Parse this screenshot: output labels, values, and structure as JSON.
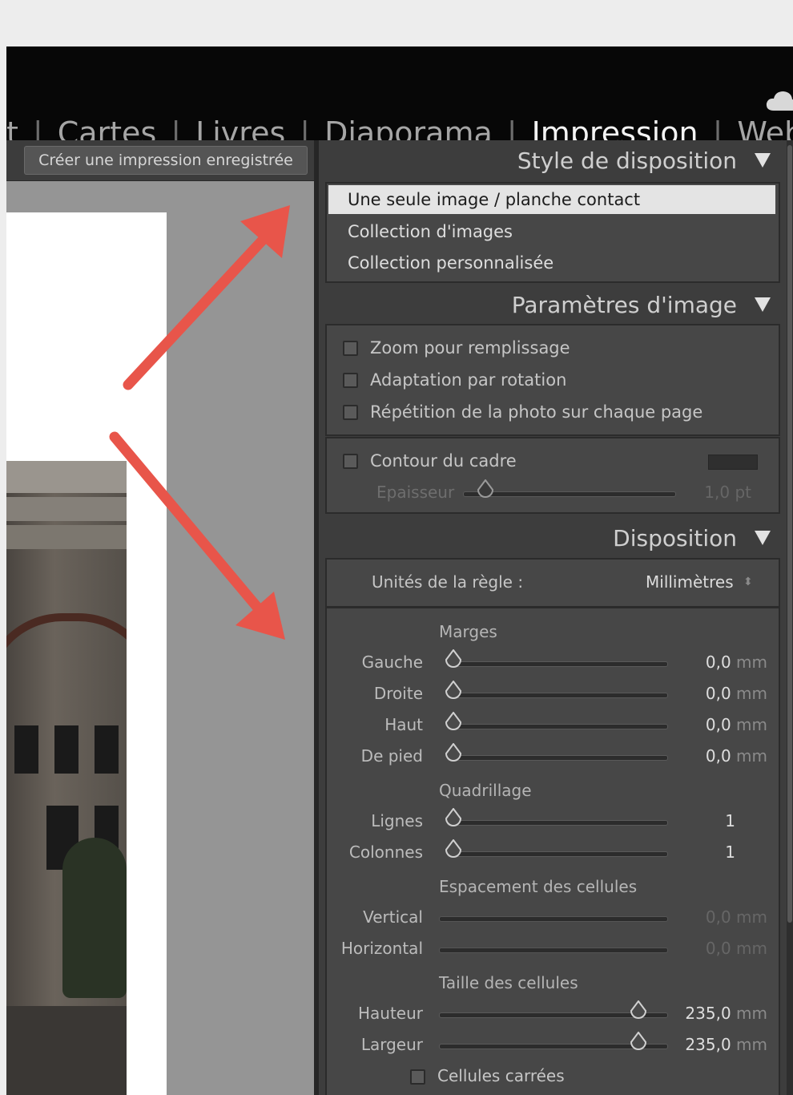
{
  "modules": {
    "items": [
      {
        "label": "t",
        "active": false
      },
      {
        "label": "Cartes",
        "active": false
      },
      {
        "label": "Livres",
        "active": false
      },
      {
        "label": "Diaporama",
        "active": false
      },
      {
        "label": "Impression",
        "active": true
      },
      {
        "label": "Web",
        "active": false
      }
    ],
    "separator": "|",
    "cloud_icon": "cloud-icon"
  },
  "left_panel": {
    "save_button": "Créer une impression enregistrée"
  },
  "layout_style": {
    "title": "Style de disposition",
    "items": [
      {
        "label": "Une seule image / planche contact",
        "selected": true
      },
      {
        "label": "Collection d'images",
        "selected": false
      },
      {
        "label": "Collection personnalisée",
        "selected": false
      }
    ]
  },
  "image_settings": {
    "title": "Paramètres d'image",
    "options": [
      {
        "label": "Zoom pour remplissage",
        "checked": false
      },
      {
        "label": "Adaptation par rotation",
        "checked": false
      },
      {
        "label": "Répétition de la photo sur chaque page",
        "checked": false
      }
    ],
    "stroke": {
      "label": "Contour du cadre",
      "checked": false,
      "width_label": "Epaisseur",
      "width_value": "1,0",
      "width_unit": "pt",
      "width_fraction": 0.08
    }
  },
  "layout": {
    "title": "Disposition",
    "ruler_units_label": "Unités de la règle :",
    "ruler_units_value": "Millimètres",
    "margins": {
      "title": "Marges",
      "rows": [
        {
          "label": "Gauche",
          "value": "0,0",
          "unit": "mm",
          "fraction": 0
        },
        {
          "label": "Droite",
          "value": "0,0",
          "unit": "mm",
          "fraction": 0
        },
        {
          "label": "Haut",
          "value": "0,0",
          "unit": "mm",
          "fraction": 0
        },
        {
          "label": "De pied",
          "value": "0,0",
          "unit": "mm",
          "fraction": 0
        }
      ]
    },
    "grid": {
      "title": "Quadrillage",
      "rows": [
        {
          "label": "Lignes",
          "value": "1",
          "fraction": 0
        },
        {
          "label": "Colonnes",
          "value": "1",
          "fraction": 0
        }
      ]
    },
    "spacing": {
      "title": "Espacement des cellules",
      "rows": [
        {
          "label": "Vertical",
          "value": "0,0",
          "unit": "mm"
        },
        {
          "label": "Horizontal",
          "value": "0,0",
          "unit": "mm"
        }
      ]
    },
    "cell_size": {
      "title": "Taille des cellules",
      "rows": [
        {
          "label": "Hauteur",
          "value": "235,0",
          "unit": "mm",
          "fraction": 0.9
        },
        {
          "label": "Largeur",
          "value": "235,0",
          "unit": "mm",
          "fraction": 0.9
        }
      ],
      "square_label": "Cellules carrées",
      "square_checked": false
    }
  },
  "annotation_color": "#e8554a"
}
